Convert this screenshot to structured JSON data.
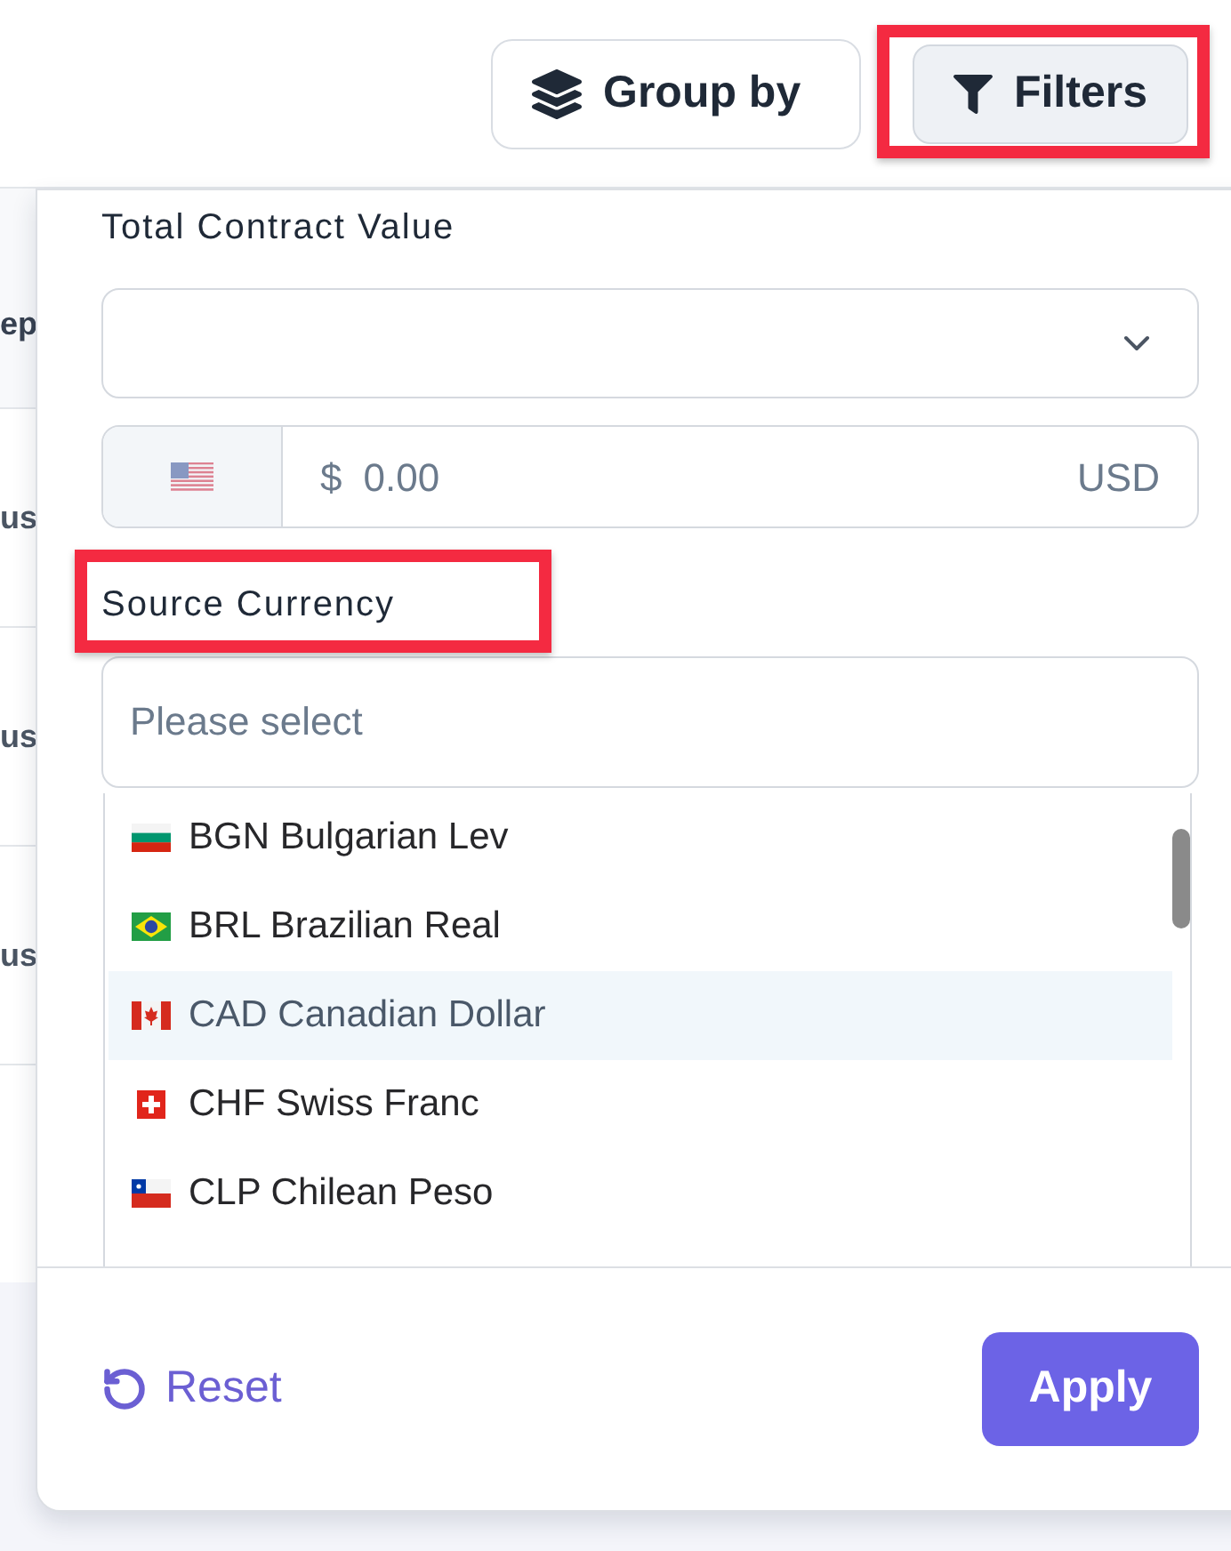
{
  "toolbar": {
    "buttons": [
      {
        "kind": "group",
        "label": "Group by",
        "active": false,
        "annotated": false
      },
      {
        "kind": "filter",
        "label": "Filters",
        "active": true,
        "annotated": true
      }
    ]
  },
  "table": {
    "header": "ep",
    "rows": [
      "us",
      "us",
      "us"
    ]
  },
  "filter_panel": {
    "value_label": {
      "text": "Total Contract Value",
      "annotated": false
    },
    "amount": {
      "kind": "us",
      "prefix": "$",
      "placeholder": "0.00",
      "currency": "USD"
    },
    "currency_label": {
      "text": "Source Currency",
      "annotated": true
    },
    "currency_search": {
      "placeholder": "Please select"
    },
    "currency_options": [
      {
        "kind": "bg",
        "label": "BGN Bulgarian Lev",
        "highlighted": false
      },
      {
        "kind": "br",
        "label": "BRL Brazilian Real",
        "highlighted": false
      },
      {
        "kind": "ca",
        "label": "CAD Canadian Dollar",
        "highlighted": true
      },
      {
        "kind": "ch",
        "label": "CHF Swiss Franc",
        "highlighted": false
      },
      {
        "kind": "cl",
        "label": "CLP Chilean Peso",
        "highlighted": false
      }
    ],
    "footer": {
      "reset": "Reset",
      "apply": "Apply"
    }
  }
}
